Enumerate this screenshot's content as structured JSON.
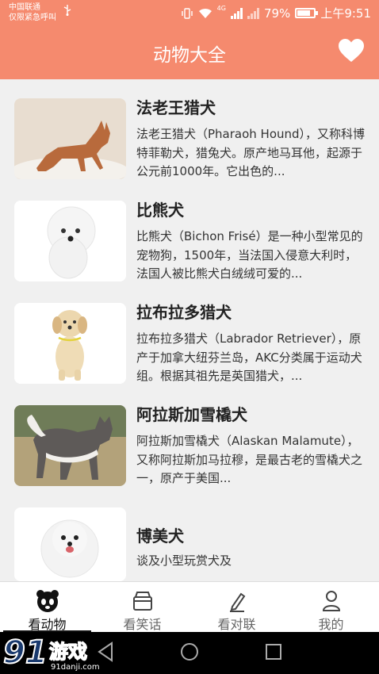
{
  "status": {
    "carrier_line1": "中国联通",
    "carrier_line2": "仅限紧急呼叫",
    "network": "4G",
    "battery": "79%",
    "time": "上午9:51"
  },
  "header": {
    "title": "动物大全"
  },
  "items": [
    {
      "title": "法老王猎犬",
      "desc": "法老王猎犬（Pharaoh Hound），又称科博特菲勒犬，猎兔犬。原产地马耳他，起源于公元前1000年。它出色的..."
    },
    {
      "title": "比熊犬",
      "desc": "比熊犬（Bichon Frisé）是一种小型常见的宠物狗，1500年，当法国入侵意大利时，法国人被比熊犬白绒绒可爱的..."
    },
    {
      "title": "拉布拉多猎犬",
      "desc": "拉布拉多猎犬（Labrador Retriever），原产于加拿大纽芬兰岛，AKC分类属于运动犬组。根据其祖先是英国猎犬，..."
    },
    {
      "title": "阿拉斯加雪橇犬",
      "desc": "阿拉斯加雪橇犬（Alaskan Malamute），又称阿拉斯加马拉穆，是最古老的雪橇犬之一，原产于美国..."
    },
    {
      "title": "博美犬",
      "desc": "谈及小型玩赏犬及"
    }
  ],
  "tabs": [
    {
      "label": "看动物",
      "icon": "panda-icon"
    },
    {
      "label": "看笑话",
      "icon": "basket-icon"
    },
    {
      "label": "看对联",
      "icon": "pen-icon"
    },
    {
      "label": "我的",
      "icon": "person-icon"
    }
  ],
  "watermark": {
    "brand": "91",
    "text": "游戏",
    "url": "91danji.com"
  },
  "colors": {
    "accent": "#f58a6e",
    "background": "#f0f0f0"
  }
}
